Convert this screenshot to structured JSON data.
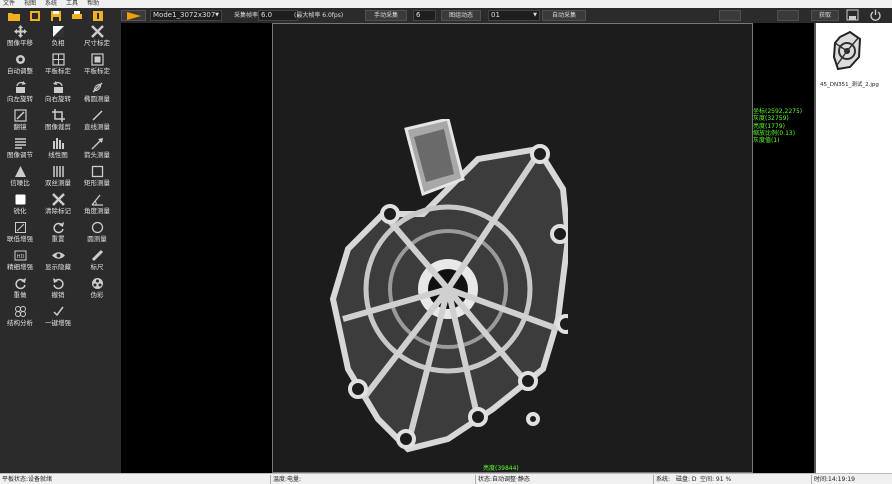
{
  "menu": [
    "文件",
    "视图",
    "系统",
    "工具",
    "帮助"
  ],
  "toolbar": {
    "icons": [
      "folder-icon",
      "export-icon",
      "save-icon",
      "print-icon",
      "info-icon"
    ],
    "mode_value": "Mode1_3072x307",
    "rate_label": "采集帧率",
    "rate_value": "6.0",
    "max_rate": "(最大帧率 6.0fps)",
    "manual_btn": "手动采集",
    "manual_value": "6",
    "combine_label": "图组动态",
    "combine_value": "01",
    "auto_btn": "自动采集",
    "fetch_btn": "获取"
  },
  "tools": [
    {
      "label": "图像平移",
      "icon": "move-icon"
    },
    {
      "label": "负相",
      "icon": "negative-icon"
    },
    {
      "label": "尺寸标定",
      "icon": "size-calibrate-icon"
    },
    {
      "label": "自动调整",
      "icon": "auto-adjust-icon"
    },
    {
      "label": "平板标定",
      "icon": "panel-calibrate-icon"
    },
    {
      "label": "平板标定",
      "icon": "panel-calibrate-2-icon"
    },
    {
      "label": "向左旋转",
      "icon": "rotate-left-icon"
    },
    {
      "label": "向右旋转",
      "icon": "rotate-right-icon"
    },
    {
      "label": "椭圆测量",
      "icon": "ellipse-measure-icon"
    },
    {
      "label": "翻镜",
      "icon": "mirror-icon"
    },
    {
      "label": "图像裁剪",
      "icon": "crop-icon"
    },
    {
      "label": "直线测量",
      "icon": "line-measure-icon"
    },
    {
      "label": "图像调节",
      "icon": "image-adjust-icon"
    },
    {
      "label": "线性图",
      "icon": "histogram-icon"
    },
    {
      "label": "箭头测量",
      "icon": "arrow-measure-icon"
    },
    {
      "label": "信噪比",
      "icon": "snr-icon"
    },
    {
      "label": "双丝测量",
      "icon": "double-wire-icon"
    },
    {
      "label": "矩形测量",
      "icon": "rect-measure-icon"
    },
    {
      "label": "锐化",
      "icon": "sharpen-icon"
    },
    {
      "label": "清除标记",
      "icon": "clear-marks-icon"
    },
    {
      "label": "角度测量",
      "icon": "angle-measure-icon"
    },
    {
      "label": "联低增强",
      "icon": "low-enhance-icon"
    },
    {
      "label": "重置",
      "icon": "reset-icon"
    },
    {
      "label": "圆测量",
      "icon": "circle-measure-icon"
    },
    {
      "label": "精细增强",
      "icon": "hd-enhance-icon"
    },
    {
      "label": "显示隐藏",
      "icon": "eye-icon"
    },
    {
      "label": "标尺",
      "icon": "ruler-icon"
    },
    {
      "label": "重做",
      "icon": "redo-icon"
    },
    {
      "label": "撤销",
      "icon": "undo-icon"
    },
    {
      "label": "伪彩",
      "icon": "pseudo-color-icon"
    },
    {
      "label": "结构分析",
      "icon": "structure-icon"
    },
    {
      "label": "一键增强",
      "icon": "one-click-enhance-icon"
    }
  ],
  "info": {
    "lines": [
      "坐标(2592,2275)",
      "灰度(32759)",
      "亮度(1779)",
      "缩放比例(0.13)",
      "灰度值(1)"
    ],
    "bottom": "亮度(39844)"
  },
  "thumbnail": {
    "name": "45_DN351_测试_2.jpg"
  },
  "status": {
    "device": "平板状态:设备就绪",
    "temp": "温度:电量:",
    "mode": "状态:自动调整·静态",
    "system": "系统:",
    "disk": "磁盘: D",
    "space": "空间: 91 %",
    "time": "时间:14:19:19"
  },
  "colors": {
    "accent_green": "#5dff2a",
    "toolbar_bg": "#2b2b2b",
    "play_orange": "#f0a000"
  }
}
